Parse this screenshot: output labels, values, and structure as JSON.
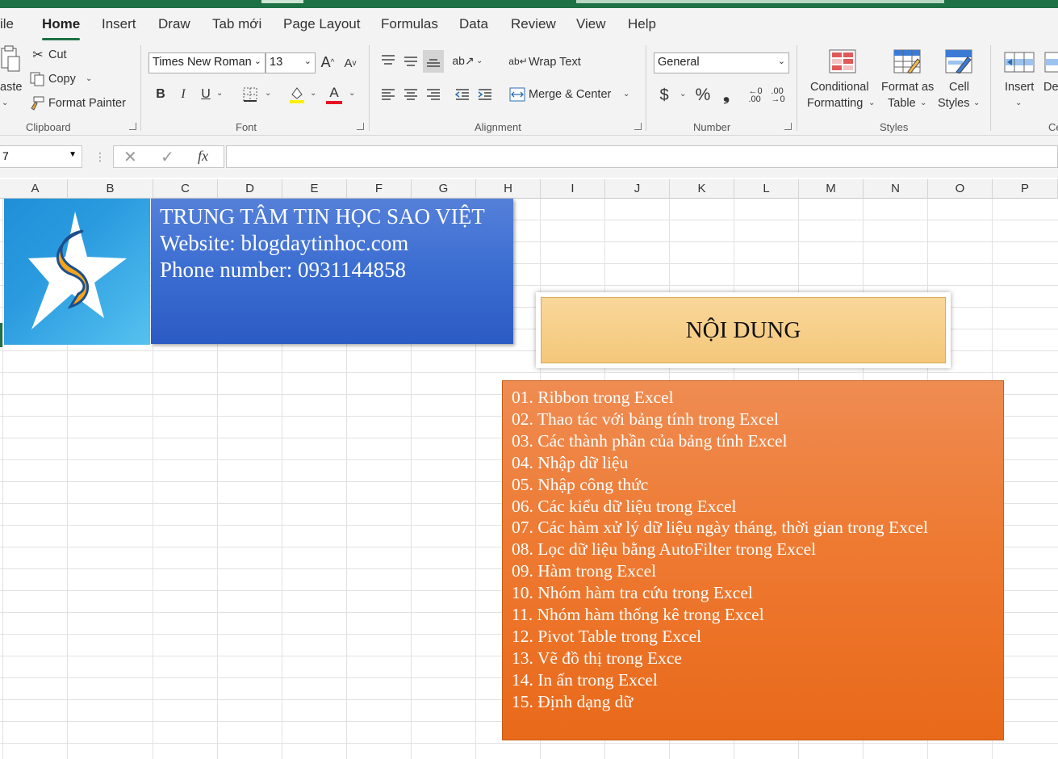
{
  "tabs": [
    "ile",
    "Home",
    "Insert",
    "Draw",
    "Tab mới",
    "Page Layout",
    "Formulas",
    "Data",
    "Review",
    "View",
    "Help"
  ],
  "clipboard": {
    "paste_label": "aste",
    "cut_label": "Cut",
    "copy_label": "Copy",
    "format_painter_label": "Format Painter",
    "group_label": "Clipboard"
  },
  "font": {
    "family": "Times New Roman",
    "size": "13",
    "group_label": "Font",
    "bold": "B",
    "italic": "I",
    "underline": "U"
  },
  "alignment": {
    "wrap_text_label": "Wrap Text",
    "merge_center_label": "Merge & Center",
    "group_label": "Alignment"
  },
  "number": {
    "format": "General",
    "currency": "$",
    "percent": "%",
    "comma": "❟",
    "group_label": "Number"
  },
  "styles": {
    "conditional_formatting": [
      "Conditional",
      "Formatting"
    ],
    "format_as_table": [
      "Format as",
      "Table"
    ],
    "cell_styles": [
      "Cell",
      "Styles"
    ],
    "group_label": "Styles"
  },
  "cells": {
    "insert_label": "Insert",
    "delete_label": "De",
    "group_label": "Ce"
  },
  "formula_bar": {
    "name_box": "7",
    "fx": "fx"
  },
  "columns": [
    "A",
    "B",
    "C",
    "D",
    "E",
    "F",
    "G",
    "H",
    "I",
    "J",
    "K",
    "L",
    "M",
    "N",
    "O",
    "P"
  ],
  "banner": {
    "line1": "TRUNG TÂM TIN HỌC SAO VIỆT",
    "line2": "Website: blogdaytinhoc.com",
    "line3": "Phone number: 0931144858"
  },
  "heading": "NỘI DUNG",
  "content_items": [
    "01. Ribbon trong Excel",
    "02. Thao tác với bảng tính trong Excel",
    "03. Các thành phần của bảng tính Excel",
    "04. Nhập dữ liệu",
    "05. Nhập công thức",
    "06. Các kiểu dữ liệu trong Excel",
    "07. Các hàm xử lý dữ liệu ngày tháng, thời gian trong Excel",
    "08. Lọc dữ liệu bằng AutoFilter trong Excel",
    "09. Hàm trong Excel",
    "10. Nhóm hàm tra cứu trong Excel",
    "11. Nhóm hàm thống kê trong Excel",
    "12. Pivot Table trong Excel",
    "13. Vẽ đồ thị trong Exce",
    "14. In ấn trong Excel",
    "15. Định dạng dữ"
  ],
  "colors": {
    "accent": "#1e7145",
    "banner": "#3d6fd2",
    "heading": "#f6cc82",
    "content": "#ee7a32"
  }
}
